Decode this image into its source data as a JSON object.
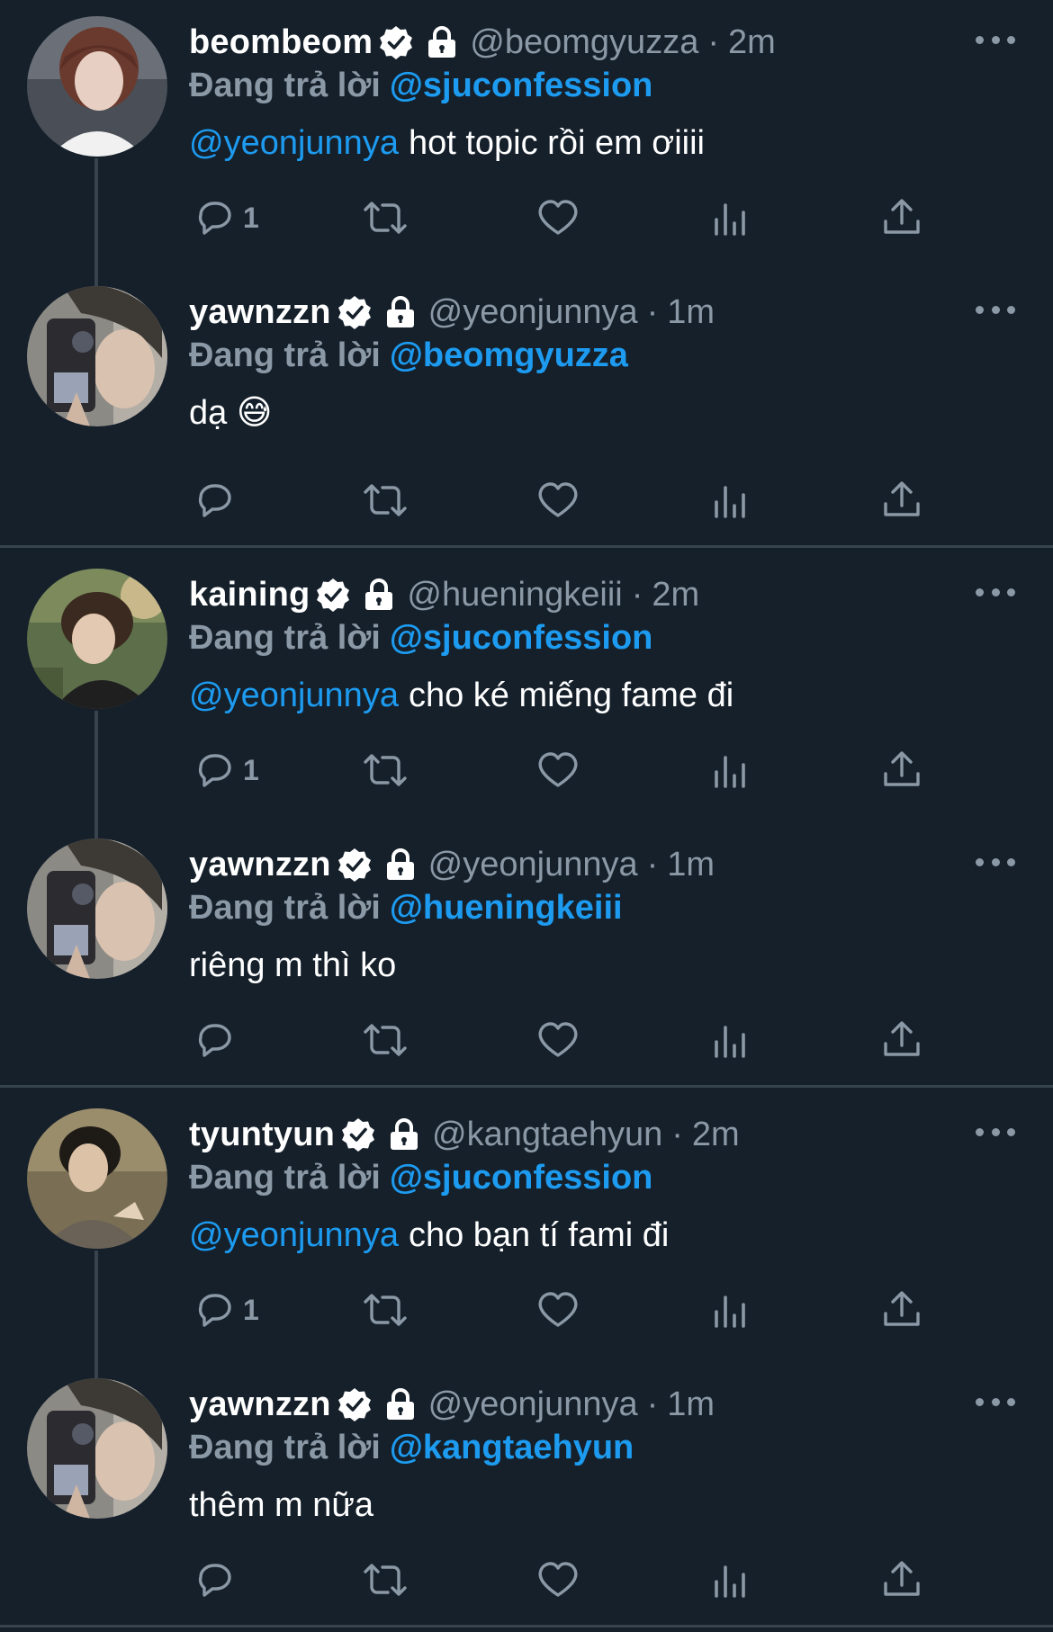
{
  "accent_color": "#1d9bf0",
  "muted_color": "#8b98a5",
  "background_color": "#15202b",
  "threads": [
    {
      "tweets": [
        {
          "name": "beombeom",
          "handle": "@beomgyuzza",
          "dot": "·",
          "time": "2m",
          "replying_label": "Đang trả lời",
          "replying_to": "@sjuconfession",
          "mention": "@yeonjunnya",
          "text": "hot topic rồi em ơiiii",
          "reply_count": "1",
          "verified_icon": "verified-badge-icon",
          "lock_icon": "lock-icon"
        },
        {
          "name": "yawnzzn",
          "handle": "@yeonjunnya",
          "dot": "·",
          "time": "1m",
          "replying_label": "Đang trả lời",
          "replying_to": "@beomgyuzza",
          "mention": "",
          "text": "dạ 😅",
          "reply_count": "",
          "verified_icon": "verified-badge-icon",
          "lock_icon": "lock-icon"
        }
      ]
    },
    {
      "tweets": [
        {
          "name": "kaining",
          "handle": "@hueningkeiii",
          "dot": "·",
          "time": "2m",
          "replying_label": "Đang trả lời",
          "replying_to": "@sjuconfession",
          "mention": "@yeonjunnya",
          "text": "cho ké miếng fame đi",
          "reply_count": "1",
          "verified_icon": "verified-badge-icon",
          "lock_icon": "lock-icon"
        },
        {
          "name": "yawnzzn",
          "handle": "@yeonjunnya",
          "dot": "·",
          "time": "1m",
          "replying_label": "Đang trả lời",
          "replying_to": "@hueningkeiii",
          "mention": "",
          "text": "riêng m thì ko",
          "reply_count": "",
          "verified_icon": "verified-badge-icon",
          "lock_icon": "lock-icon"
        }
      ]
    },
    {
      "tweets": [
        {
          "name": "tyuntyun",
          "handle": "@kangtaehyun",
          "dot": "·",
          "time": "2m",
          "replying_label": "Đang trả lời",
          "replying_to": "@sjuconfession",
          "mention": "@yeonjunnya",
          "text": "cho bạn tí fami đi",
          "reply_count": "1",
          "verified_icon": "verified-badge-icon",
          "lock_icon": "lock-icon"
        },
        {
          "name": "yawnzzn",
          "handle": "@yeonjunnya",
          "dot": "·",
          "time": "1m",
          "replying_label": "Đang trả lời",
          "replying_to": "@kangtaehyun",
          "mention": "",
          "text": "thêm m nữa",
          "reply_count": "",
          "verified_icon": "verified-badge-icon",
          "lock_icon": "lock-icon"
        }
      ]
    }
  ]
}
